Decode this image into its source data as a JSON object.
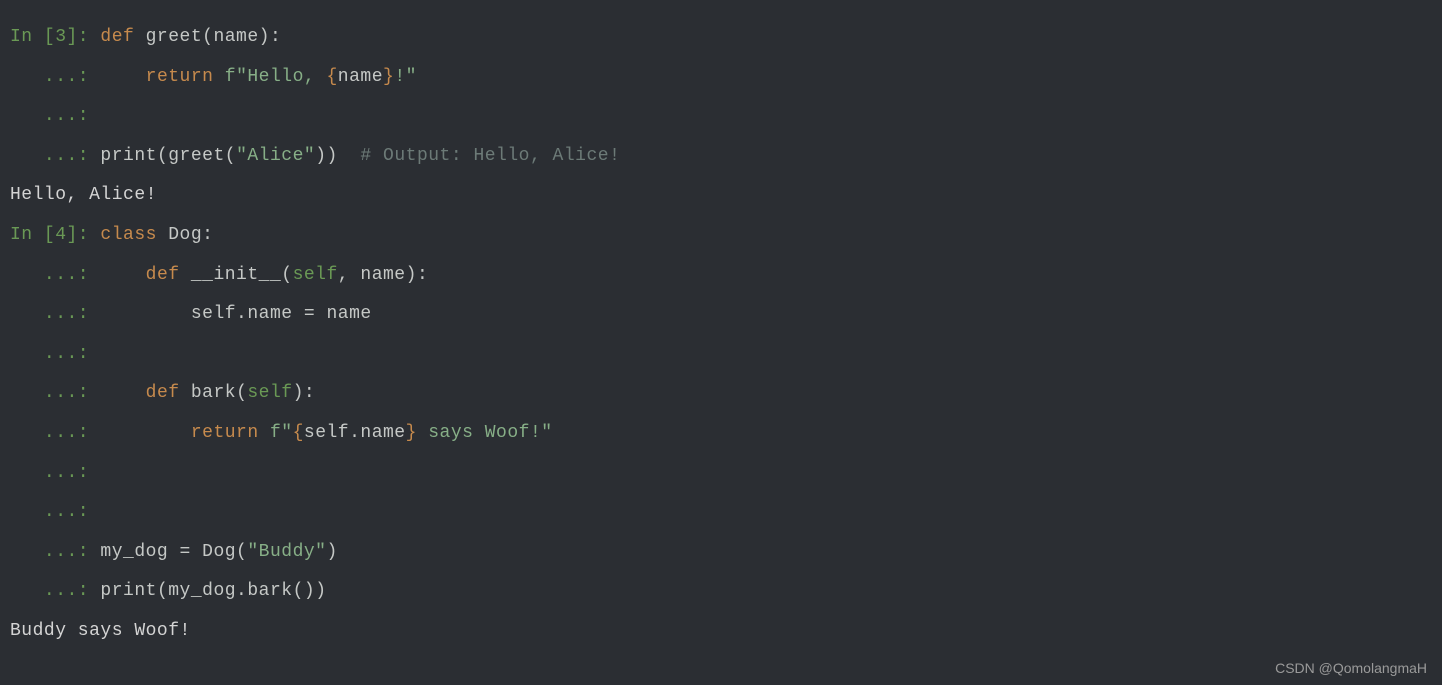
{
  "cell3": {
    "prompt": "In [3]: ",
    "cont": "   ...: ",
    "line1": {
      "def": "def",
      "func": " greet",
      "paren_open": "(",
      "arg": "name",
      "paren_close": ")",
      "colon": ":"
    },
    "line2": {
      "indent": "    ",
      "return": "return",
      "space": " ",
      "fstr1": "f\"Hello, ",
      "brace_open": "{",
      "var": "name",
      "brace_close": "}",
      "fstr2": "!\""
    },
    "line3": "",
    "line4": {
      "print": "print",
      "open1": "(",
      "greet": "greet",
      "open2": "(",
      "arg": "\"Alice\"",
      "close2": ")",
      "close1": ")",
      "comment": "  # Output: Hello, Alice!"
    },
    "output": "Hello, Alice!"
  },
  "cell4": {
    "prompt": "In [4]: ",
    "cont": "   ...: ",
    "line1": {
      "class": "class",
      "name": " Dog",
      "colon": ":"
    },
    "line2": {
      "indent": "    ",
      "def": "def",
      "func": " __init__",
      "open": "(",
      "self": "self",
      "comma": ", ",
      "arg": "name",
      "close": ")",
      "colon": ":"
    },
    "line3": {
      "indent": "        ",
      "code": "self.name = name"
    },
    "line4": "",
    "line5": {
      "indent": "    ",
      "def": "def",
      "func": " bark",
      "open": "(",
      "self": "self",
      "close": ")",
      "colon": ":"
    },
    "line6": {
      "indent": "        ",
      "return": "return",
      "space": " ",
      "fstr1": "f\"",
      "brace_open": "{",
      "var": "self.name",
      "brace_close": "}",
      "fstr2": " says Woof!\""
    },
    "line7": "",
    "line8": "",
    "line9": {
      "lhs": "my_dog = Dog",
      "open": "(",
      "arg": "\"Buddy\"",
      "close": ")"
    },
    "line10": {
      "print": "print",
      "open": "(",
      "code": "my_dog.bark",
      "open2": "(",
      "close2": ")",
      "close": ")"
    },
    "output": "Buddy says Woof!"
  },
  "watermark": "CSDN @QomolangmaH"
}
